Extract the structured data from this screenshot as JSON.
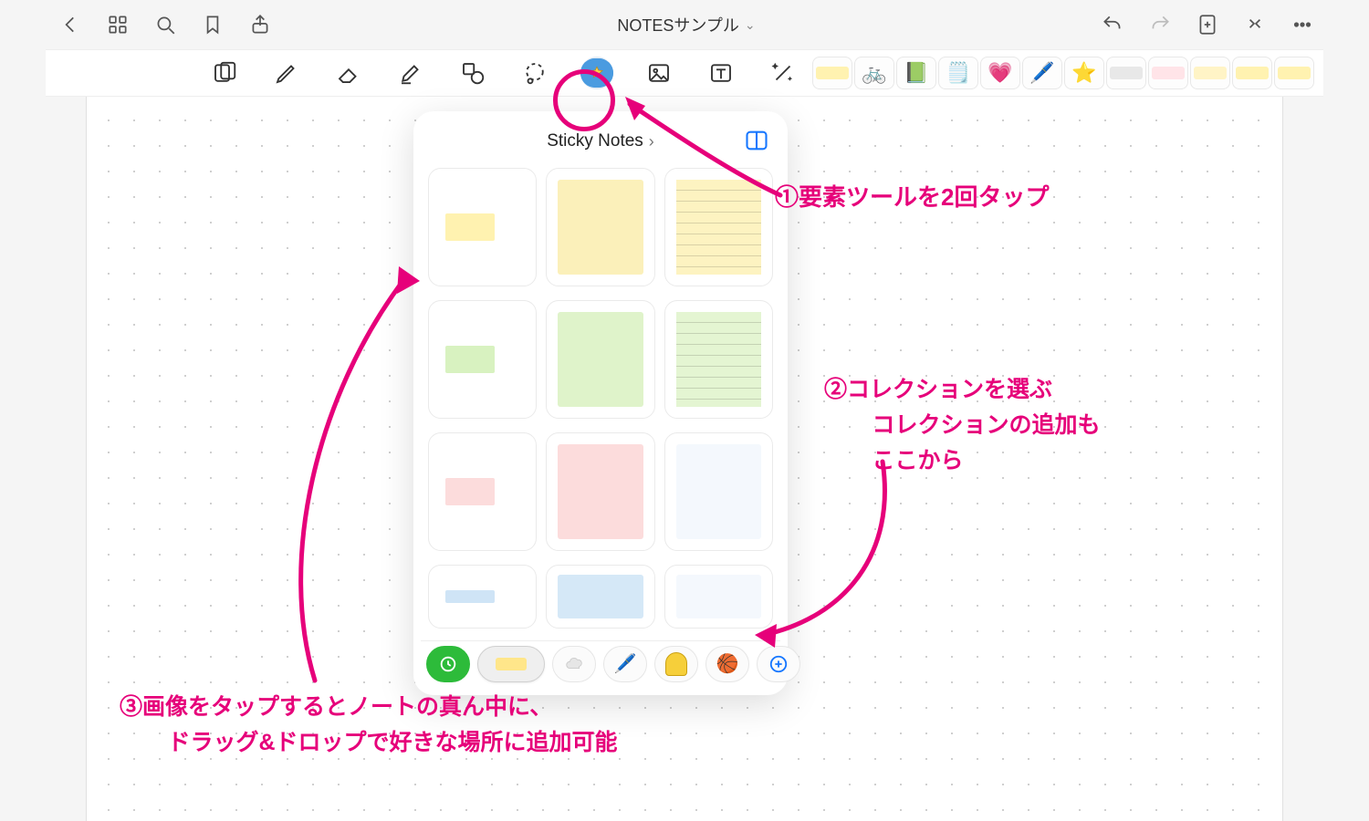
{
  "header": {
    "title": "NOTESサンプル",
    "dropdown_caret": "⌄"
  },
  "toolbar": {
    "tools": [
      {
        "name": "read-mode-icon"
      },
      {
        "name": "pen-icon"
      },
      {
        "name": "eraser-icon"
      },
      {
        "name": "highlighter-icon"
      },
      {
        "name": "shape-icon"
      },
      {
        "name": "lasso-icon"
      },
      {
        "name": "elements-icon",
        "selected": true
      },
      {
        "name": "image-icon"
      },
      {
        "name": "text-icon"
      },
      {
        "name": "magic-icon"
      }
    ],
    "recents": [
      {
        "name": "recent-yellow-memo",
        "kind": "swatch",
        "color": "#fff2b0"
      },
      {
        "name": "recent-bicycle",
        "kind": "emoji",
        "glyph": "🚲"
      },
      {
        "name": "recent-green-book",
        "kind": "emoji",
        "glyph": "📗"
      },
      {
        "name": "recent-collage",
        "kind": "emoji",
        "glyph": "🗒️"
      },
      {
        "name": "recent-heart",
        "kind": "emoji",
        "glyph": "💗"
      },
      {
        "name": "recent-pen",
        "kind": "emoji",
        "glyph": "🖊️"
      },
      {
        "name": "recent-star",
        "kind": "emoji",
        "glyph": "⭐"
      },
      {
        "name": "recent-cloud",
        "kind": "swatch",
        "color": "#e8e8e8"
      },
      {
        "name": "recent-pink-memo",
        "kind": "swatch",
        "color": "#ffe4e8"
      },
      {
        "name": "recent-yellow2",
        "kind": "swatch",
        "color": "#fff4c6"
      },
      {
        "name": "recent-yellow3",
        "kind": "swatch",
        "color": "#fff2b0"
      },
      {
        "name": "recent-yellow4",
        "kind": "swatch",
        "color": "#fff2b0"
      }
    ]
  },
  "panel": {
    "title": "Sticky Notes",
    "caret": "›",
    "stickies_rows": [
      [
        {
          "name": "sticky-yellow-tab",
          "bg": "#ffffff",
          "tab": "#fff2b0"
        },
        {
          "name": "sticky-yellow-square",
          "bg": "#fbf0ba"
        },
        {
          "name": "sticky-yellow-lined",
          "bg": "#fdf3c1",
          "lines": true
        }
      ],
      [
        {
          "name": "sticky-green-tab",
          "bg": "#ffffff",
          "tab": "#d8f2c0"
        },
        {
          "name": "sticky-green-square",
          "bg": "#dff3ca"
        },
        {
          "name": "sticky-green-lined",
          "bg": "#e4f5d2",
          "lines": true
        }
      ],
      [
        {
          "name": "sticky-pink-tab",
          "bg": "#ffffff",
          "tab": "#fcdcdc"
        },
        {
          "name": "sticky-pink-square",
          "bg": "#fcdcdc"
        },
        {
          "name": "sticky-blue-grid",
          "bg": "#f4f8fd",
          "grid": true
        }
      ],
      [
        {
          "name": "sticky-blue-tab",
          "bg": "#ffffff",
          "tab": "#cfe4f6",
          "short": true
        },
        {
          "name": "sticky-blue-square",
          "bg": "#d5e8f7",
          "short": true
        },
        {
          "name": "sticky-blue-dots",
          "bg": "#f4f8fd",
          "dots": true,
          "short": true
        }
      ]
    ],
    "tabs": [
      {
        "name": "collection-recent",
        "kind": "green-time"
      },
      {
        "name": "collection-stickynotes",
        "kind": "selected-yellow"
      },
      {
        "name": "collection-clouds",
        "kind": "cloud"
      },
      {
        "name": "collection-pens",
        "kind": "pens"
      },
      {
        "name": "collection-badges",
        "kind": "badge"
      },
      {
        "name": "collection-ball",
        "kind": "ball"
      },
      {
        "name": "collection-add",
        "kind": "add"
      }
    ]
  },
  "annotations": {
    "a1": "①要素ツールを2回タップ",
    "a2_l1": "②コレクションを選ぶ",
    "a2_l2": "コレクションの追加も",
    "a2_l3": "ここから",
    "a3_l1": "③画像をタップするとノートの真ん中に、",
    "a3_l2": "ドラッグ&ドロップで好きな場所に追加可能"
  }
}
